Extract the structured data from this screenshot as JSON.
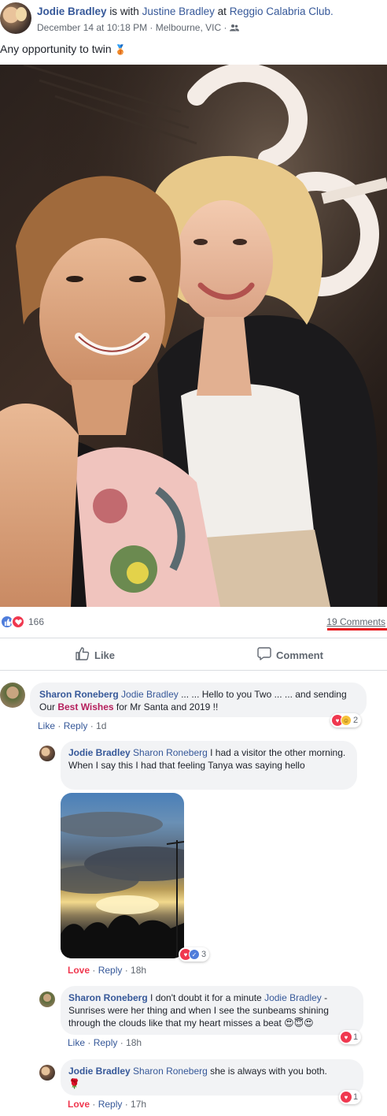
{
  "post": {
    "author": "Jodie Bradley",
    "is_with_text": "is with",
    "tagged": "Justine Bradley",
    "at_text": "at",
    "place": "Reggio Calabria Club.",
    "date": "December 14 at 10:18 PM",
    "location": "Melbourne, VIC",
    "sep": "·",
    "text": "Any opportunity to twin",
    "text_emoji": "🥉"
  },
  "reactions": {
    "count": "166",
    "comments": "19 Comments"
  },
  "actions": {
    "like": "Like",
    "comment": "Comment"
  },
  "comments": [
    {
      "author": "Sharon Roneberg",
      "tag": "Jodie Bradley",
      "text_1": " ... ... Hello to you Two ... ... and sending Our ",
      "highlight": "Best Wishes",
      "text_2": " for Mr Santa and 2019 !!",
      "like": "Like",
      "reply": "Reply",
      "time": "1d",
      "react_count": "2"
    },
    {
      "author": "Jodie Bradley",
      "tag": "Sharon Roneberg",
      "text": " I had a visitor the other morning. When I say this I had that feeling Tanya was saying hello",
      "like": "Love",
      "reply": "Reply",
      "time": "18h",
      "react_count": "3"
    },
    {
      "author": "Sharon Roneberg",
      "text_1": " I don't doubt it for a minute ",
      "tag": "Jodie Bradley",
      "text_2": " - Sunrises were her thing and when I see the sunbeams shining through the clouds like that my heart misses a beat ",
      "emojis": "😍😇😍",
      "like": "Like",
      "reply": "Reply",
      "time": "18h",
      "react_count": "1"
    },
    {
      "author": "Jodie Bradley",
      "tag": "Sharon Roneberg",
      "text": " she is always with you both.",
      "emoji": "🌹",
      "like": "Love",
      "reply": "Reply",
      "time": "17h",
      "react_count": "1"
    }
  ],
  "icons": {
    "like": "thumbs-up-icon",
    "comment": "speech-bubble-icon",
    "friends": "friends-icon",
    "love": "heart-icon",
    "haha": "laughing-face-icon"
  },
  "colors": {
    "link": "#365899",
    "meta": "#606770",
    "love": "#f0384f",
    "like": "#4f7ddb",
    "underline_highlight": "#e8171c",
    "bubble": "#f2f3f5",
    "best_wishes": "#b5205d"
  }
}
